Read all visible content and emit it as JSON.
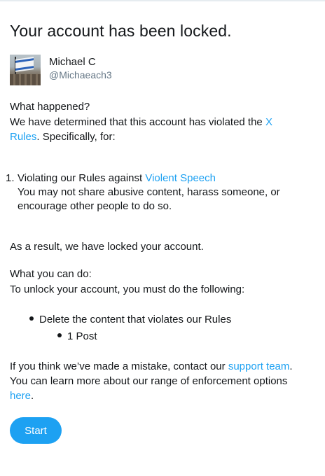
{
  "page": {
    "title": "Your account has been locked."
  },
  "user": {
    "name": "Michael C",
    "handle": "@Michaeach3"
  },
  "what_happened": {
    "heading": "What happened?",
    "text_before_link": "We have determined that this account has violated the ",
    "link_text_line1": "X",
    "link_text_line2": "Rules",
    "text_after_link": ". Specifically, for:"
  },
  "violations": [
    {
      "number": "1.",
      "title_prefix": "Violating our Rules against ",
      "title_link": "Violent Speech",
      "description": "You may not share abusive content, harass someone, or encourage other people to do so."
    }
  ],
  "result_text": "As a result, we have locked your account.",
  "what_you_can_do": {
    "heading": "What you can do:",
    "text": "To unlock your account, you must do the following:",
    "steps": [
      {
        "label": "Delete the content that violates our Rules",
        "sub": [
          "1 Post"
        ]
      }
    ]
  },
  "footer": {
    "text_before_support": "If you think we’ve made a mistake, contact our ",
    "support_link": "support team",
    "text_after_support": ".",
    "learn_more_text": "You can learn more about our range of enforcement options",
    "here_link": "here",
    "here_after": "."
  },
  "buttons": {
    "start_label": "Start"
  },
  "colors": {
    "link": "#1da1f2",
    "button_bg": "#1da1f2",
    "text": "#14171a",
    "secondary_text": "#657786"
  },
  "icons": {
    "avatar": "profile-photo-flag"
  }
}
